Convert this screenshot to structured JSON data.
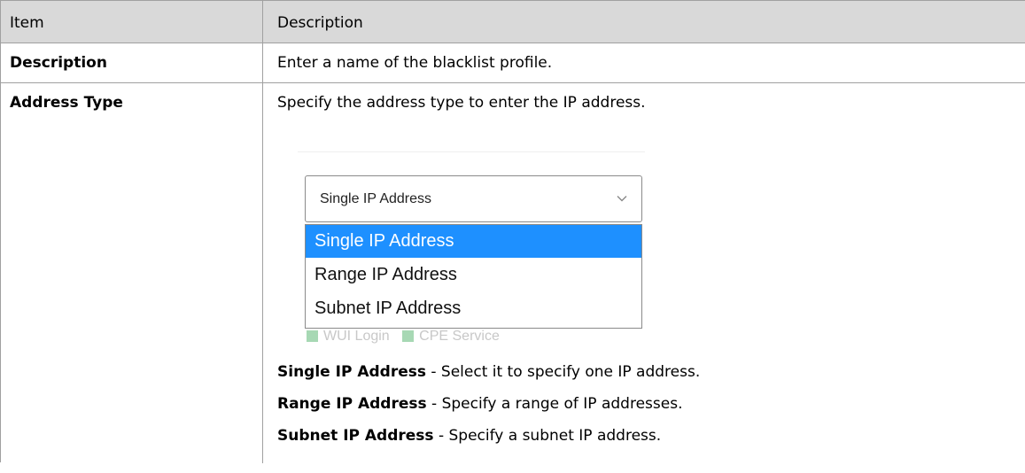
{
  "header": {
    "col1": "Item",
    "col2": "Description"
  },
  "rows": {
    "description": {
      "item": "Description",
      "text": "Enter a name of the blacklist profile."
    },
    "address_type": {
      "item": "Address Type",
      "intro": "Specify the address type to enter the IP address.",
      "select": {
        "value": "Single IP Address",
        "options": [
          "Single IP Address",
          "Range IP Address",
          "Subnet IP Address"
        ],
        "behind_text_1": "WUI Login",
        "behind_text_2": "CPE Service"
      },
      "definitions": [
        {
          "term": "Single IP Address",
          "text": " - Select it to specify one IP address."
        },
        {
          "term": "Range IP Address",
          "text": " - Specify a range of IP addresses."
        },
        {
          "term": "Subnet IP Address",
          "text": " - Specify a subnet IP address."
        }
      ]
    }
  },
  "colors": {
    "header_bg": "#d9d9d9",
    "selected_option": "#1e90ff",
    "border": "#a0a0a0"
  }
}
